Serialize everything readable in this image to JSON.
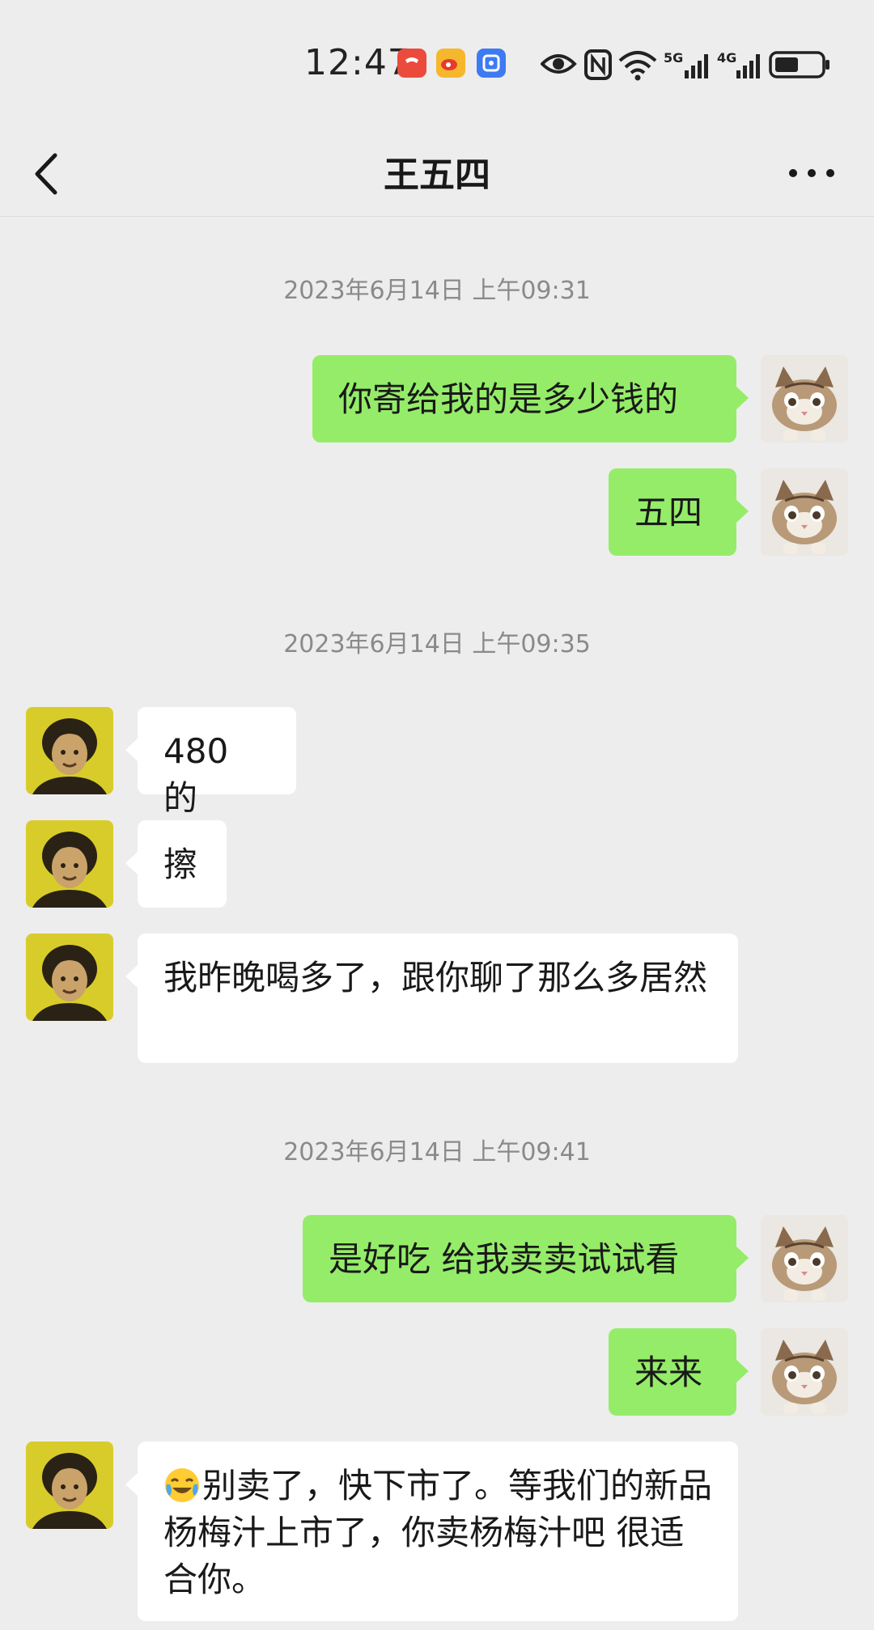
{
  "status_bar": {
    "time": "12:47",
    "network_5g": "5G",
    "network_4g": "4G"
  },
  "header": {
    "title": "王五四"
  },
  "messages": [
    {
      "type": "timestamp",
      "text": "2023年6月14日 上午09:31"
    },
    {
      "type": "out",
      "text": "你寄给我的是多少钱的"
    },
    {
      "type": "out",
      "text": "五四"
    },
    {
      "type": "timestamp",
      "text": "2023年6月14日 上午09:35"
    },
    {
      "type": "in",
      "text": "480 的"
    },
    {
      "type": "in",
      "text": "擦"
    },
    {
      "type": "in",
      "text": "我昨晚喝多了，跟你聊了那么多居然"
    },
    {
      "type": "timestamp",
      "text": "2023年6月14日 上午09:41"
    },
    {
      "type": "out",
      "text": "是好吃 给我卖卖试试看"
    },
    {
      "type": "out",
      "text": "来来"
    },
    {
      "type": "in",
      "emoji": "crying-laughing-emoji",
      "text": "别卖了，快下市了。等我们的新品杨梅汁上市了，你卖杨梅汁吧 很适合你。"
    }
  ],
  "colors": {
    "background": "#ededed",
    "outgoing_bubble": "#95ec69",
    "incoming_bubble": "#ffffff",
    "timestamp_text": "#8a8a8a"
  }
}
